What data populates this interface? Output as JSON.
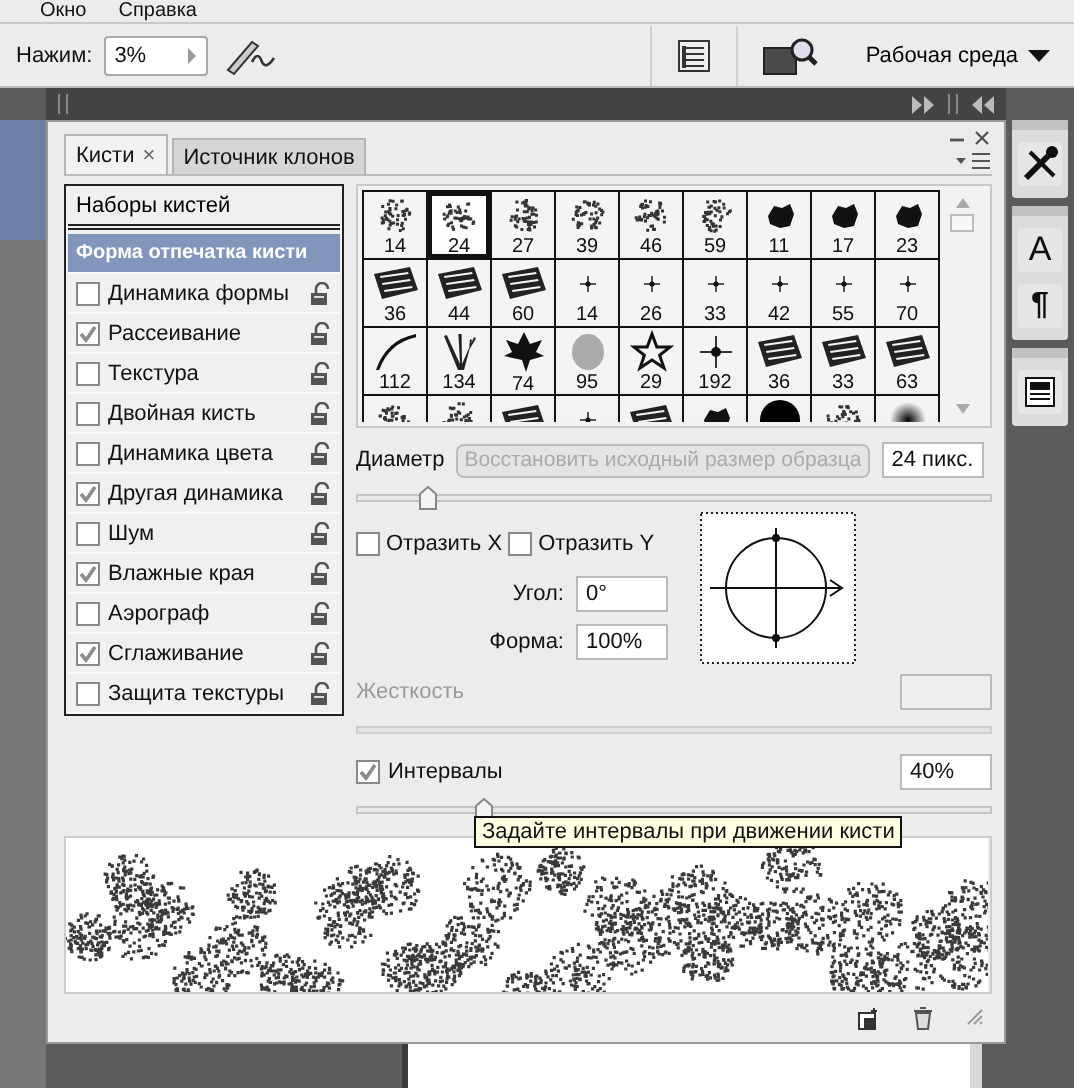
{
  "menu": [
    {
      "label": "Окно"
    },
    {
      "label": "Справка"
    }
  ],
  "options_bar": {
    "pressure_label": "Нажим:",
    "pressure_value": "3%",
    "workspace": "Рабочая среда"
  },
  "dock_glyphs": {
    "character": "A",
    "paragraph": "¶"
  },
  "tabs": [
    {
      "label": "Кисти",
      "close": "×",
      "selected": true
    },
    {
      "label": "Источник клонов",
      "selected": false
    }
  ],
  "presets_button": "Наборы кистей",
  "settings": [
    {
      "label": "Форма отпечатка кисти",
      "kind": "section",
      "selected": true
    },
    {
      "label": "Динамика формы",
      "kind": "option",
      "checked": false,
      "selected": false
    },
    {
      "label": "Рассеивание",
      "kind": "option",
      "checked": true,
      "selected": false
    },
    {
      "label": "Текстура",
      "kind": "option",
      "checked": false,
      "selected": false
    },
    {
      "label": "Двойная кисть",
      "kind": "option",
      "checked": false,
      "selected": false
    },
    {
      "label": "Динамика цвета",
      "kind": "option",
      "checked": false,
      "selected": false
    },
    {
      "label": "Другая динамика",
      "kind": "option",
      "checked": true,
      "selected": false
    },
    {
      "label": "Шум",
      "kind": "option",
      "checked": false,
      "selected": false
    },
    {
      "label": "Влажные края",
      "kind": "option",
      "checked": true,
      "selected": false
    },
    {
      "label": "Аэрограф",
      "kind": "option",
      "checked": false,
      "selected": false
    },
    {
      "label": "Сглаживание",
      "kind": "option",
      "checked": true,
      "selected": false
    },
    {
      "label": "Защита текстуры",
      "kind": "option",
      "checked": false,
      "selected": false
    }
  ],
  "brushes": [
    {
      "size": "14",
      "kind": "scatter",
      "selected": false
    },
    {
      "size": "24",
      "kind": "scatter",
      "selected": true
    },
    {
      "size": "27",
      "kind": "scatter",
      "selected": false
    },
    {
      "size": "39",
      "kind": "scatter",
      "selected": false
    },
    {
      "size": "46",
      "kind": "scatter",
      "selected": false
    },
    {
      "size": "59",
      "kind": "scatter",
      "selected": false
    },
    {
      "size": "11",
      "kind": "blob",
      "selected": false
    },
    {
      "size": "17",
      "kind": "blob",
      "selected": false
    },
    {
      "size": "23",
      "kind": "blob",
      "selected": false
    },
    {
      "size": "36",
      "kind": "stamp",
      "selected": false
    },
    {
      "size": "44",
      "kind": "stamp",
      "selected": false
    },
    {
      "size": "60",
      "kind": "stamp",
      "selected": false
    },
    {
      "size": "14",
      "kind": "dot",
      "selected": false
    },
    {
      "size": "26",
      "kind": "dot",
      "selected": false
    },
    {
      "size": "33",
      "kind": "dot",
      "selected": false
    },
    {
      "size": "42",
      "kind": "dot",
      "selected": false
    },
    {
      "size": "55",
      "kind": "dot",
      "selected": false
    },
    {
      "size": "70",
      "kind": "dot",
      "selected": false
    },
    {
      "size": "112",
      "kind": "curve",
      "selected": false
    },
    {
      "size": "134",
      "kind": "grass",
      "selected": false
    },
    {
      "size": "74",
      "kind": "maple",
      "selected": false
    },
    {
      "size": "95",
      "kind": "leaf",
      "selected": false
    },
    {
      "size": "29",
      "kind": "star",
      "selected": false
    },
    {
      "size": "192",
      "kind": "burst",
      "selected": false
    },
    {
      "size": "36",
      "kind": "stamp",
      "selected": false
    },
    {
      "size": "33",
      "kind": "stamp",
      "selected": false
    },
    {
      "size": "63",
      "kind": "stamp",
      "selected": false
    },
    {
      "kind": "scatter",
      "selected": false
    },
    {
      "kind": "scatter",
      "selected": false
    },
    {
      "kind": "stamp",
      "selected": false
    },
    {
      "kind": "dot",
      "selected": false
    },
    {
      "kind": "stamp",
      "selected": false
    },
    {
      "kind": "blob",
      "selected": false
    },
    {
      "kind": "hard",
      "selected": false
    },
    {
      "kind": "scatter",
      "selected": false
    },
    {
      "kind": "soft",
      "selected": false
    }
  ],
  "diameter": {
    "label": "Диаметр",
    "reset_button": "Восстановить исходный размер образца",
    "value": "24 пикс.",
    "level": 0.11
  },
  "flip_x": {
    "label": "Отразить X",
    "checked": false
  },
  "flip_y": {
    "label": "Отразить Y",
    "checked": false
  },
  "angle": {
    "label": "Угол:",
    "value": "0°"
  },
  "roundness": {
    "label": "Форма:",
    "value": "100%"
  },
  "hardness": {
    "label": "Жесткость",
    "disabled": true
  },
  "spacing": {
    "label": "Интервалы",
    "checked": true,
    "value": "40%",
    "level": 0.2
  },
  "tooltip": "Задайте интервалы при движении кисти"
}
